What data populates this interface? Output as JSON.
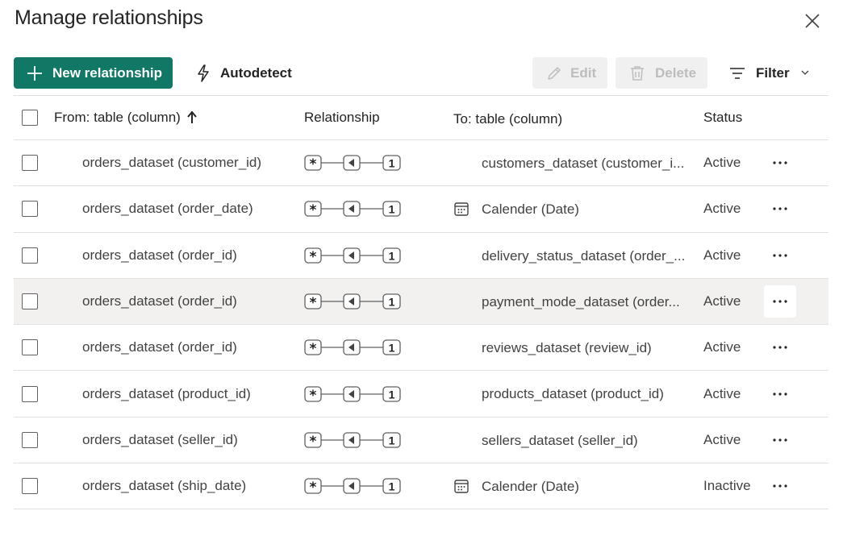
{
  "dialog": {
    "title": "Manage relationships"
  },
  "toolbar": {
    "new_label": "New relationship",
    "autodetect_label": "Autodetect",
    "edit_label": "Edit",
    "delete_label": "Delete",
    "filter_label": "Filter"
  },
  "table": {
    "headers": {
      "from": "From: table (column)",
      "relationship": "Relationship",
      "to": "To: table (column)",
      "status": "Status"
    },
    "rows": [
      {
        "from": "orders_dataset (customer_id)",
        "many": "*",
        "one": "1",
        "to": "customers_dataset (customer_i...",
        "to_icon": "",
        "status": "Active",
        "more": "···"
      },
      {
        "from": "orders_dataset (order_date)",
        "many": "*",
        "one": "1",
        "to": "Calender (Date)",
        "to_icon": "calendar-icon",
        "status": "Active",
        "more": "···"
      },
      {
        "from": "orders_dataset (order_id)",
        "many": "*",
        "one": "1",
        "to": "delivery_status_dataset (order_...",
        "to_icon": "",
        "status": "Active",
        "more": "···"
      },
      {
        "from": "orders_dataset (order_id)",
        "many": "*",
        "one": "1",
        "to": "payment_mode_dataset (order...",
        "to_icon": "",
        "status": "Active",
        "more": "···"
      },
      {
        "from": "orders_dataset (order_id)",
        "many": "*",
        "one": "1",
        "to": "reviews_dataset (review_id)",
        "to_icon": "",
        "status": "Active",
        "more": "···"
      },
      {
        "from": "orders_dataset (product_id)",
        "many": "*",
        "one": "1",
        "to": "products_dataset (product_id)",
        "to_icon": "",
        "status": "Active",
        "more": "···"
      },
      {
        "from": "orders_dataset (seller_id)",
        "many": "*",
        "one": "1",
        "to": "sellers_dataset (seller_id)",
        "to_icon": "",
        "status": "Active",
        "more": "···"
      },
      {
        "from": "orders_dataset (ship_date)",
        "many": "*",
        "one": "1",
        "to": "Calender (Date)",
        "to_icon": "calendar-icon",
        "status": "Inactive",
        "more": "···"
      }
    ]
  },
  "colors": {
    "primary": "#117865",
    "hover_row": "#f2f1f0",
    "disabled_bg": "#f0f0f0",
    "disabled_text": "#bdbdbd"
  }
}
